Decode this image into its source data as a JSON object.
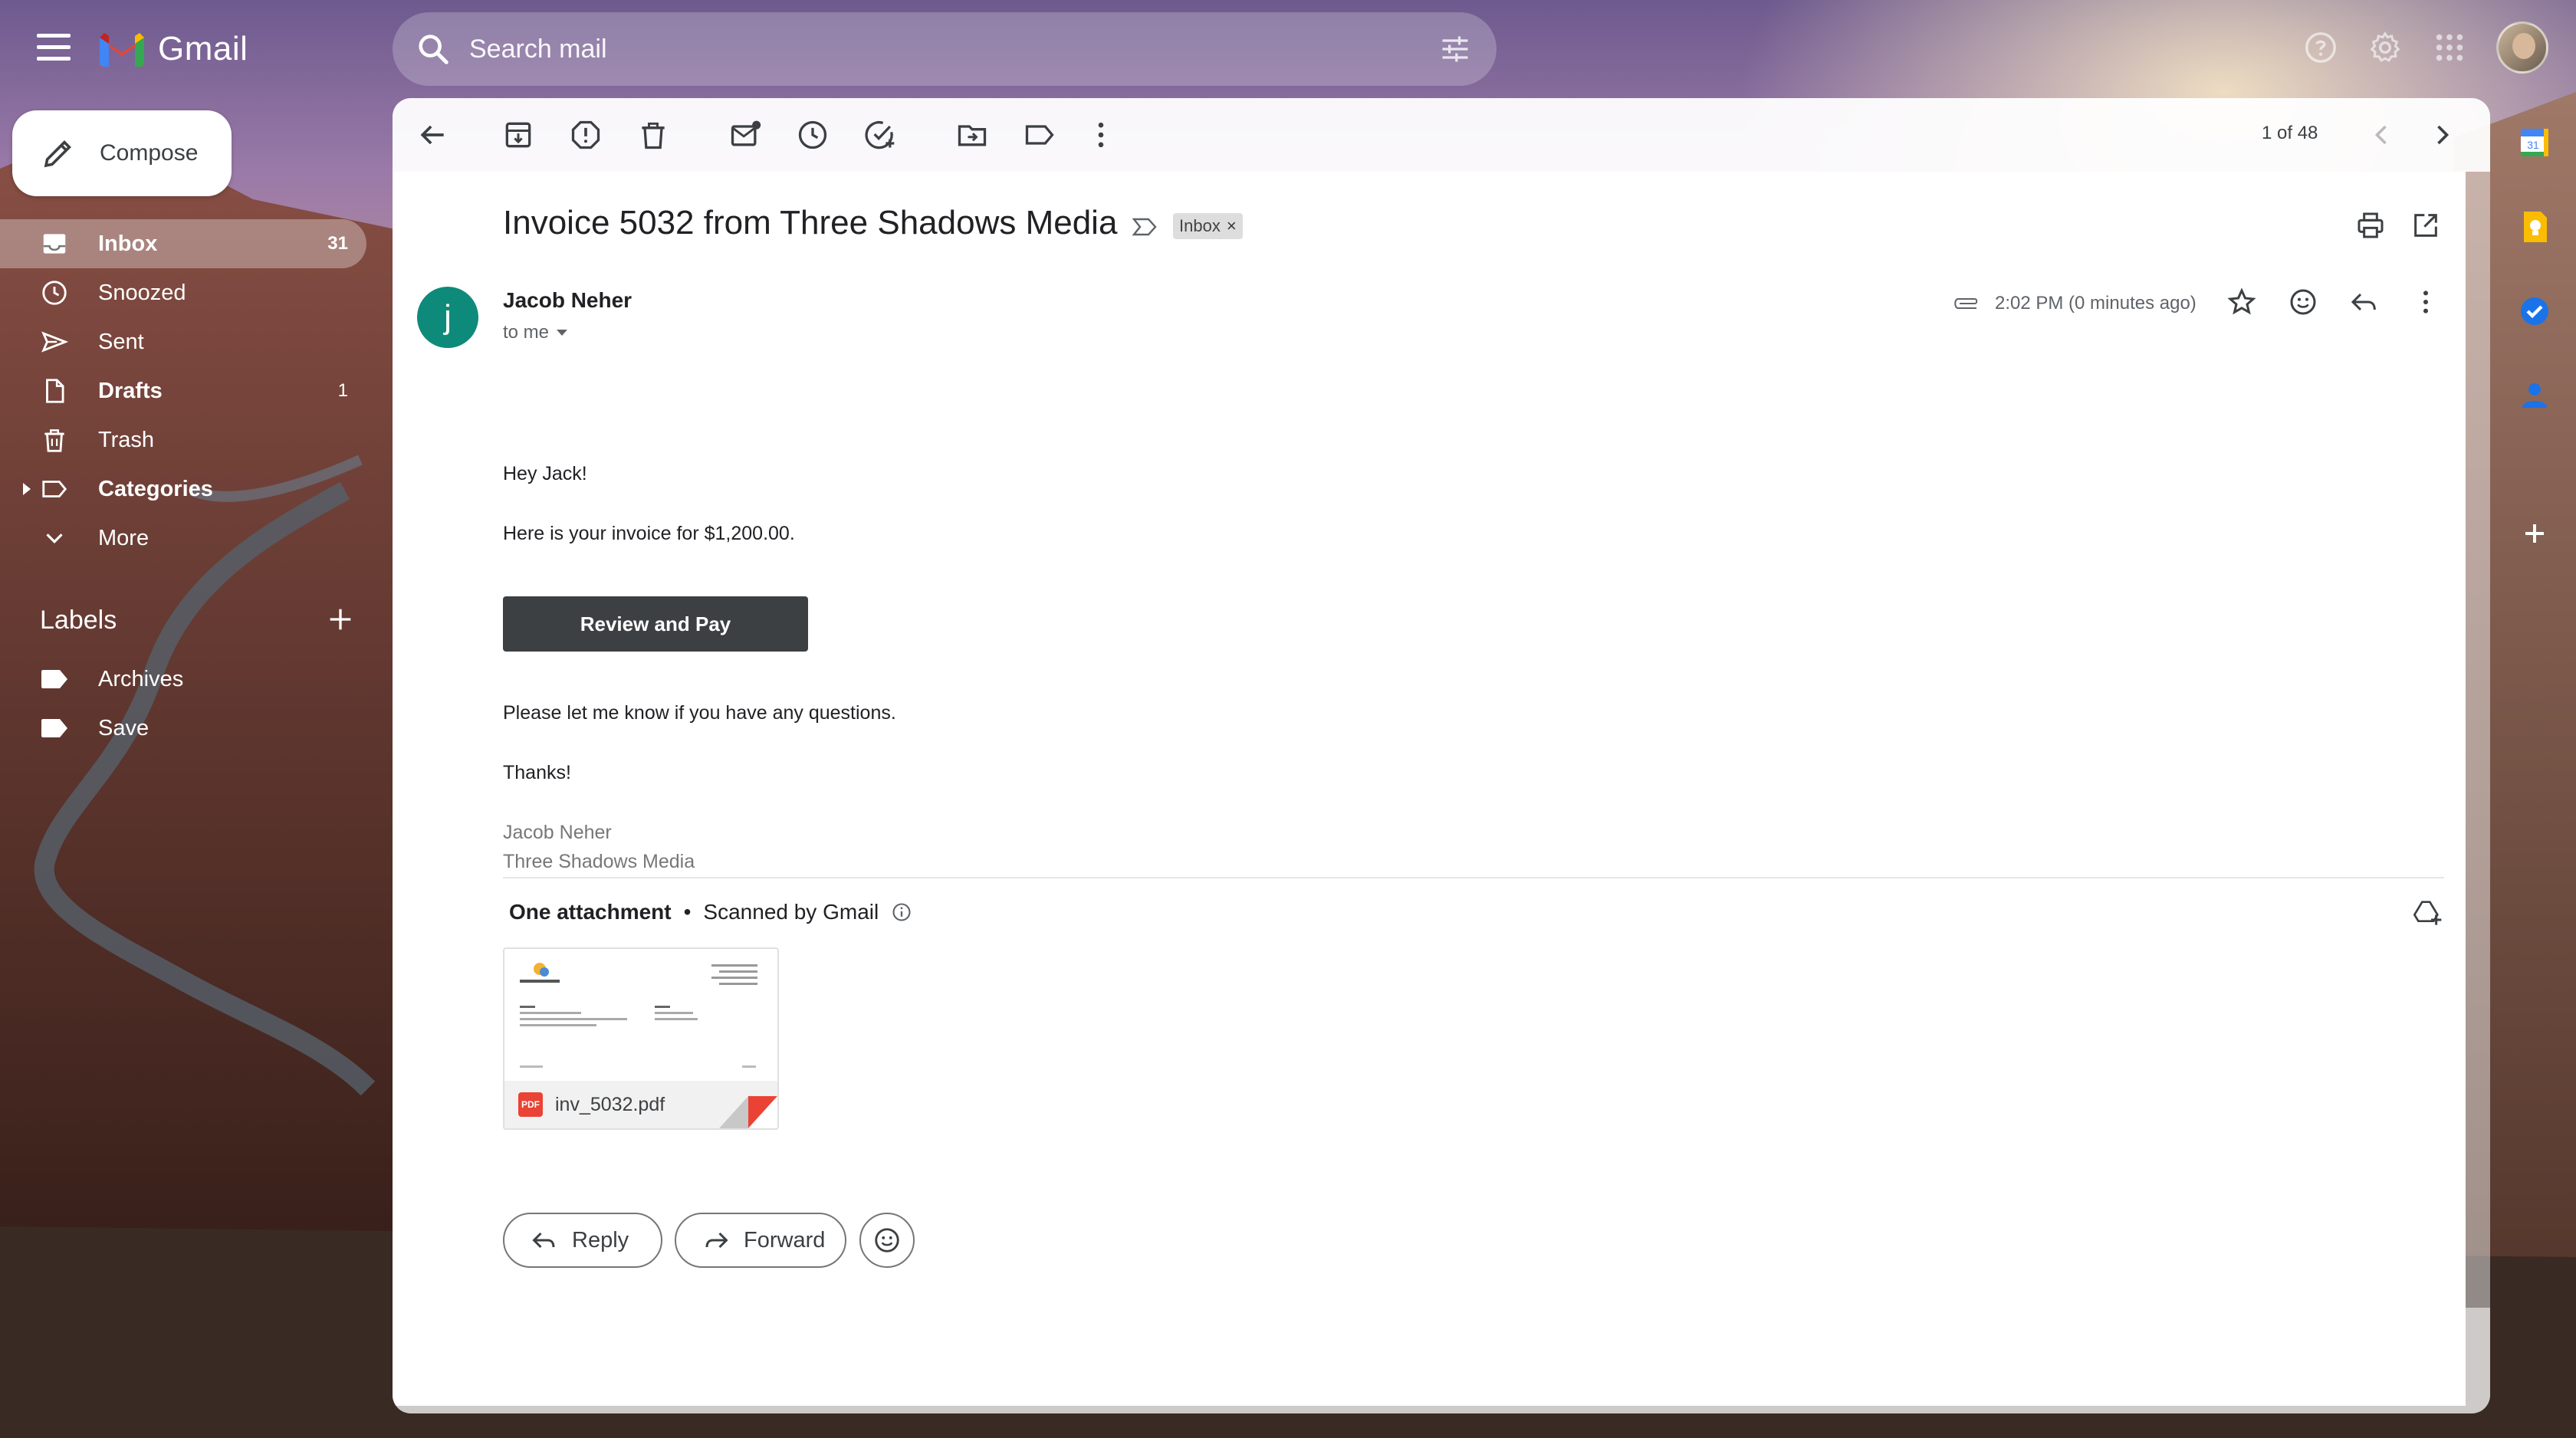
{
  "header": {
    "brand": "Gmail",
    "search_placeholder": "Search mail"
  },
  "compose": {
    "label": "Compose"
  },
  "nav": {
    "items": [
      {
        "label": "Inbox",
        "count": "31"
      },
      {
        "label": "Snoozed",
        "count": ""
      },
      {
        "label": "Sent",
        "count": ""
      },
      {
        "label": "Drafts",
        "count": "1"
      },
      {
        "label": "Trash",
        "count": ""
      },
      {
        "label": "Categories",
        "count": ""
      },
      {
        "label": "More",
        "count": ""
      }
    ]
  },
  "labels": {
    "heading": "Labels",
    "items": [
      {
        "label": "Archives"
      },
      {
        "label": "Save"
      }
    ]
  },
  "toolbar": {
    "pager": "1 of 48"
  },
  "email": {
    "subject": "Invoice 5032 from Three Shadows Media",
    "chip": "Inbox",
    "chip_close": "×",
    "sender": "Jacob Neher",
    "avatar_letter": "j",
    "to": "to me",
    "time": "2:02 PM (0 minutes ago)",
    "greeting": "Hey Jack!",
    "line1": "Here is your invoice for $1,200.00.",
    "button": "Review and Pay",
    "line2": "Please let me know if you have any questions.",
    "thanks": "Thanks!",
    "sig_name": "Jacob Neher",
    "sig_company": "Three Shadows Media"
  },
  "attachments": {
    "heading": "One attachment",
    "separator": "•",
    "scanned": "Scanned by Gmail",
    "file_name": "inv_5032.pdf",
    "file_badge": "PDF"
  },
  "actions": {
    "reply": "Reply",
    "forward": "Forward"
  },
  "colors": {
    "avatar": "#0e8a7a",
    "pay_button": "#3c4043",
    "pdf": "#ea4335"
  }
}
